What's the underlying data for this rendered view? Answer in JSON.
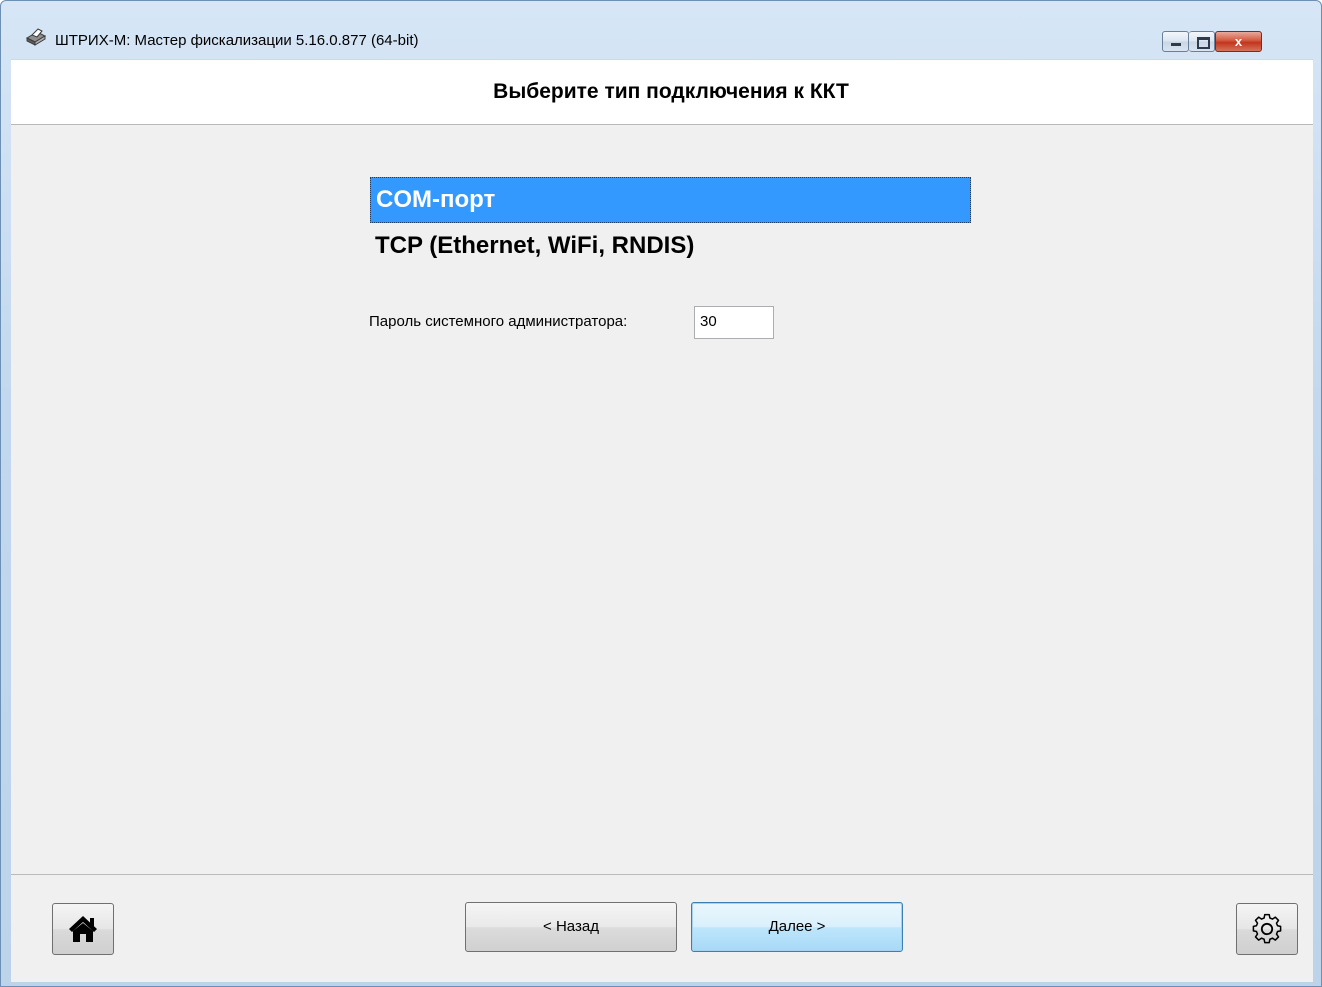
{
  "window": {
    "title": "ШТРИХ-М: Мастер фискализации 5.16.0.877 (64-bit)",
    "controls": {
      "minimize": "",
      "maximize": "",
      "close": "x"
    }
  },
  "header": {
    "title": "Выберите тип подключения к ККТ"
  },
  "connection_types": [
    {
      "label": "COM-порт",
      "selected": true
    },
    {
      "label": "TCP (Ethernet, WiFi, RNDIS)",
      "selected": false
    }
  ],
  "password": {
    "label": "Пароль системного администратора:",
    "value": "30"
  },
  "footer": {
    "home_icon": "home-icon",
    "back_label": "< Назад",
    "next_label": "Далее >",
    "settings_icon": "gear-icon"
  },
  "colors": {
    "selection": "#3399ff",
    "window_frame": "#c3d8ee",
    "client_bg": "#f0f0f0"
  }
}
